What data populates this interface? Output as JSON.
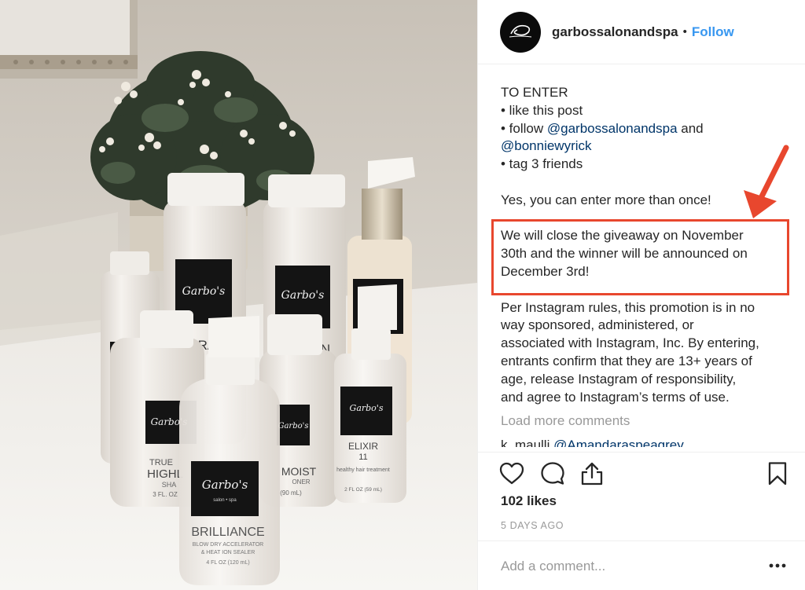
{
  "post": {
    "username": "garbossalonandspa",
    "separator": "•",
    "follow_label": "Follow"
  },
  "caption": {
    "lines": [
      "TO ENTER",
      "• like this post",
      "• follow ",
      "@garbossalonandspa",
      " and",
      "@bonniewyrick",
      "• tag 3 friends",
      "Yes, you can enter more than once!",
      "We will close the giveaway on November",
      "30th and the winner will be announced on",
      "December 3rd!",
      "Per Instagram rules, this promotion is in no",
      "way sponsored, administered, or",
      "associated with Instagram, Inc. By entering,",
      "entrants confirm that they are 13+ years of",
      "age, release Instagram of responsibility,",
      "and agree to Instagram’s terms of use."
    ]
  },
  "comments": {
    "load_more": "Load more comments",
    "next_user": "k_maulli",
    "next_mention": "@Amandaraspeagrey"
  },
  "engagement": {
    "likes": "102 likes",
    "age": "5 DAYS AGO"
  },
  "composer": {
    "placeholder": "Add a comment..."
  },
  "product_labels": {
    "brand": "Garbo's",
    "brand_sub": "salon • spa",
    "true_highlights": "TRUE",
    "highlights": "HIGHL",
    "shampoo": "SHA",
    "oz1": "3 FL. OZ",
    "moist": "MOIST",
    "conditioner": "ONER",
    "oz2": "(90 mL)",
    "elixir": "ELIXIR",
    "elixir_num": "11",
    "elixir_desc": "healthy hair treatment",
    "oz3": "2 FL OZ (59 mL)",
    "brilliance": "BRILLIANCE",
    "brilliance_desc": "BLOW DRY ACCELERATOR",
    "brilliance_desc2": "& HEAT ION SEALER",
    "oz4": "4 FL OZ (120 mL)",
    "hydrate": "RAT",
    "volume": "N"
  },
  "colors": {
    "accent": "#3897f0",
    "mention": "#003569",
    "annotation_red": "#e8472e",
    "muted": "#999999"
  },
  "icons": [
    "heart-icon",
    "comment-icon",
    "share-icon",
    "bookmark-icon",
    "more-options-icon",
    "garbo-logo-icon"
  ]
}
